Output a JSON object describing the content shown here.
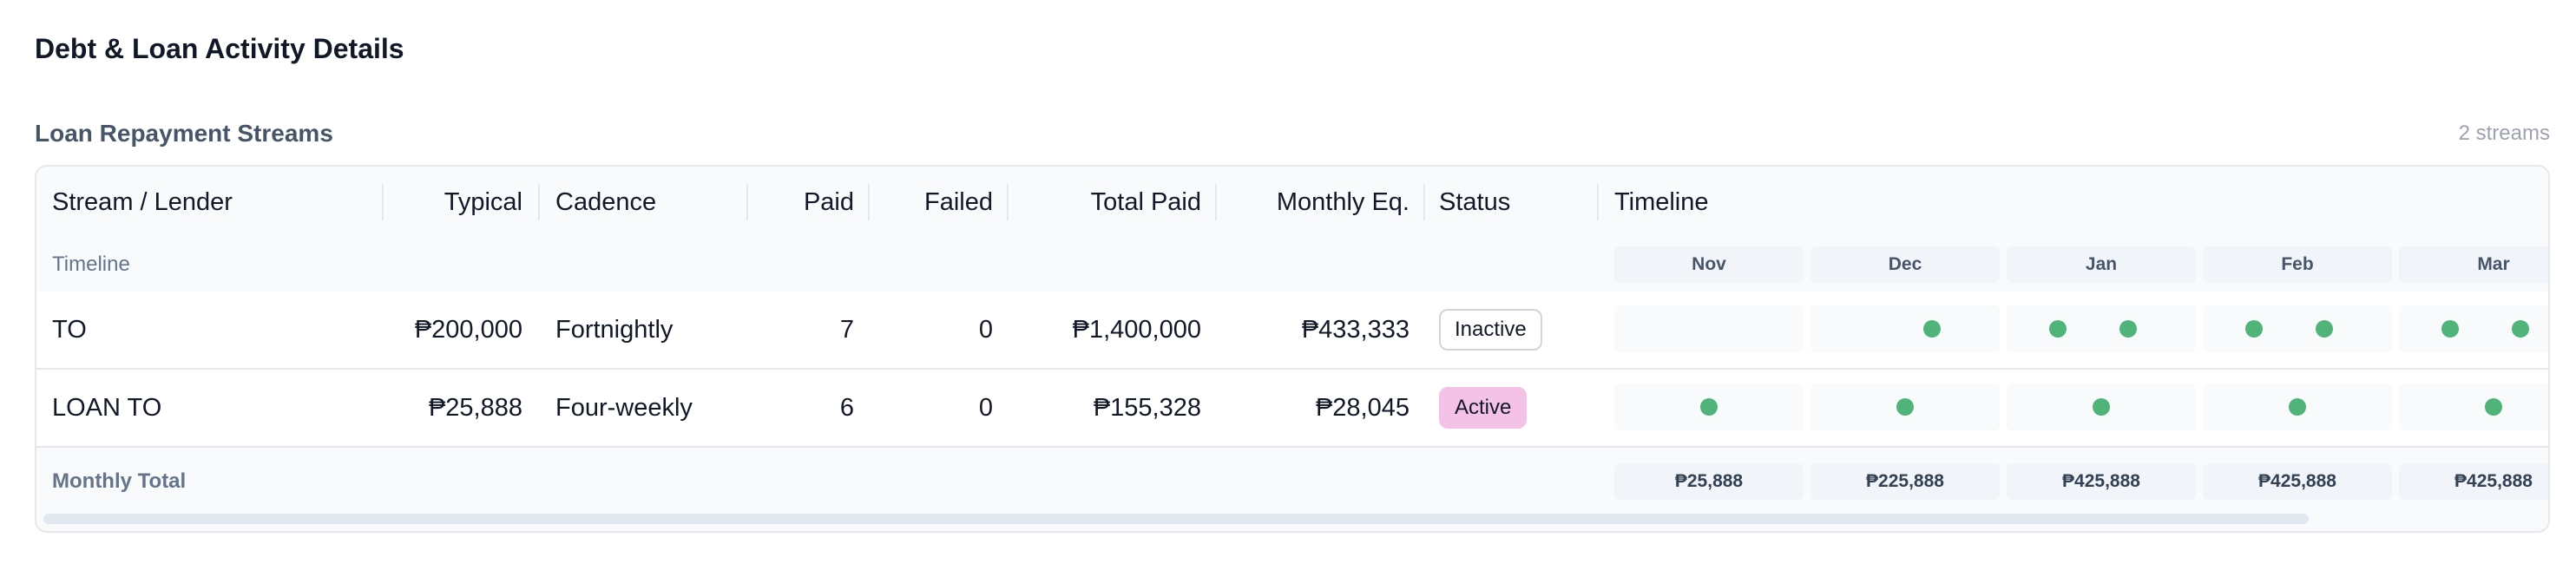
{
  "page": {
    "title": "Debt & Loan Activity Details"
  },
  "section": {
    "title": "Loan Repayment Streams",
    "count_label": "2 streams"
  },
  "table": {
    "headers": {
      "stream": "Stream / Lender",
      "typical": "Typical",
      "cadence": "Cadence",
      "paid": "Paid",
      "failed": "Failed",
      "total_paid": "Total Paid",
      "monthly_eq": "Monthly Eq.",
      "status": "Status",
      "timeline": "Timeline"
    },
    "timeline_row_label": "Timeline",
    "months": [
      "Nov",
      "Dec",
      "Jan",
      "Feb",
      "Mar"
    ],
    "rows": [
      {
        "name": "TO",
        "typical": "₱200,000",
        "cadence": "Fortnightly",
        "paid": "7",
        "failed": "0",
        "total_paid": "₱1,400,000",
        "monthly_eq": "₱433,333",
        "status": "Inactive",
        "payments_by_month": [
          0,
          1,
          2,
          2,
          2
        ]
      },
      {
        "name": "LOAN TO",
        "typical": "₱25,888",
        "cadence": "Four-weekly",
        "paid": "6",
        "failed": "0",
        "total_paid": "₱155,328",
        "monthly_eq": "₱28,045",
        "status": "Active",
        "payments_by_month": [
          1,
          1,
          1,
          1,
          1
        ]
      }
    ],
    "total_label": "Monthly Total",
    "monthly_totals": [
      "₱25,888",
      "₱225,888",
      "₱425,888",
      "₱425,888",
      "₱425,888"
    ]
  },
  "colors": {
    "dot": "#4fb37a",
    "active_badge": "#f5c2e7",
    "inactive_badge_border": "#d1d5db"
  }
}
